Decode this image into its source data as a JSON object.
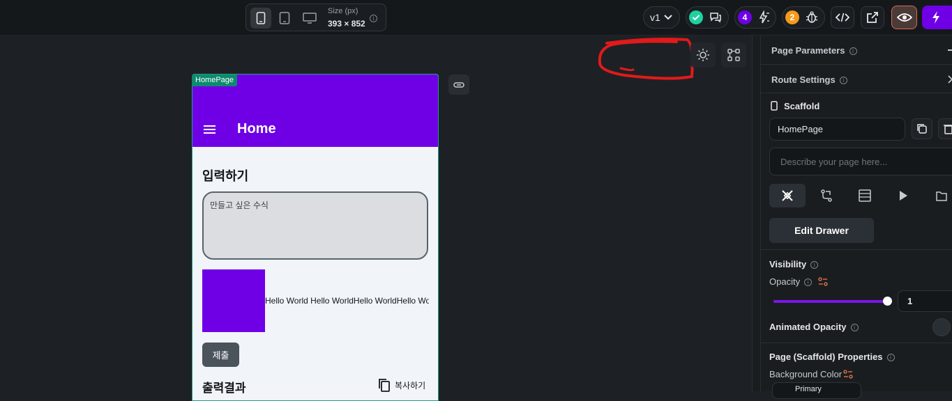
{
  "toolbar": {
    "size_label": "Size (px)",
    "size_value": "393 × 852",
    "version": "v1",
    "warnings_count": "4",
    "errors_count": "2",
    "colors": {
      "accent_purple": "#6f00e6",
      "success_teal": "#1fd1a0",
      "warning_orange": "#f49a1c",
      "preview_active": "#d86a4f"
    }
  },
  "phone": {
    "page_tag": "HomePage",
    "appbar_title": "Home",
    "input_heading": "입력하기",
    "textarea_placeholder": "만들고 싶은 수식",
    "hello_text": "Hello World Hello WorldHello WorldHello World",
    "submit_label": "제출",
    "output_heading": "출력결과",
    "copy_label": "복사하기"
  },
  "panel": {
    "page_parameters": "Page Parameters",
    "route_settings": "Route Settings",
    "scaffold": "Scaffold",
    "page_name": "HomePage",
    "description_placeholder": "Describe your page here...",
    "edit_drawer": "Edit Drawer",
    "visibility": "Visibility",
    "opacity": "Opacity",
    "opacity_value": "1",
    "opacity_level": 1,
    "animated_opacity": "Animated Opacity",
    "scaffold_properties": "Page (Scaffold) Properties",
    "background_color": "Background Color",
    "background_color_value": "Primary"
  }
}
